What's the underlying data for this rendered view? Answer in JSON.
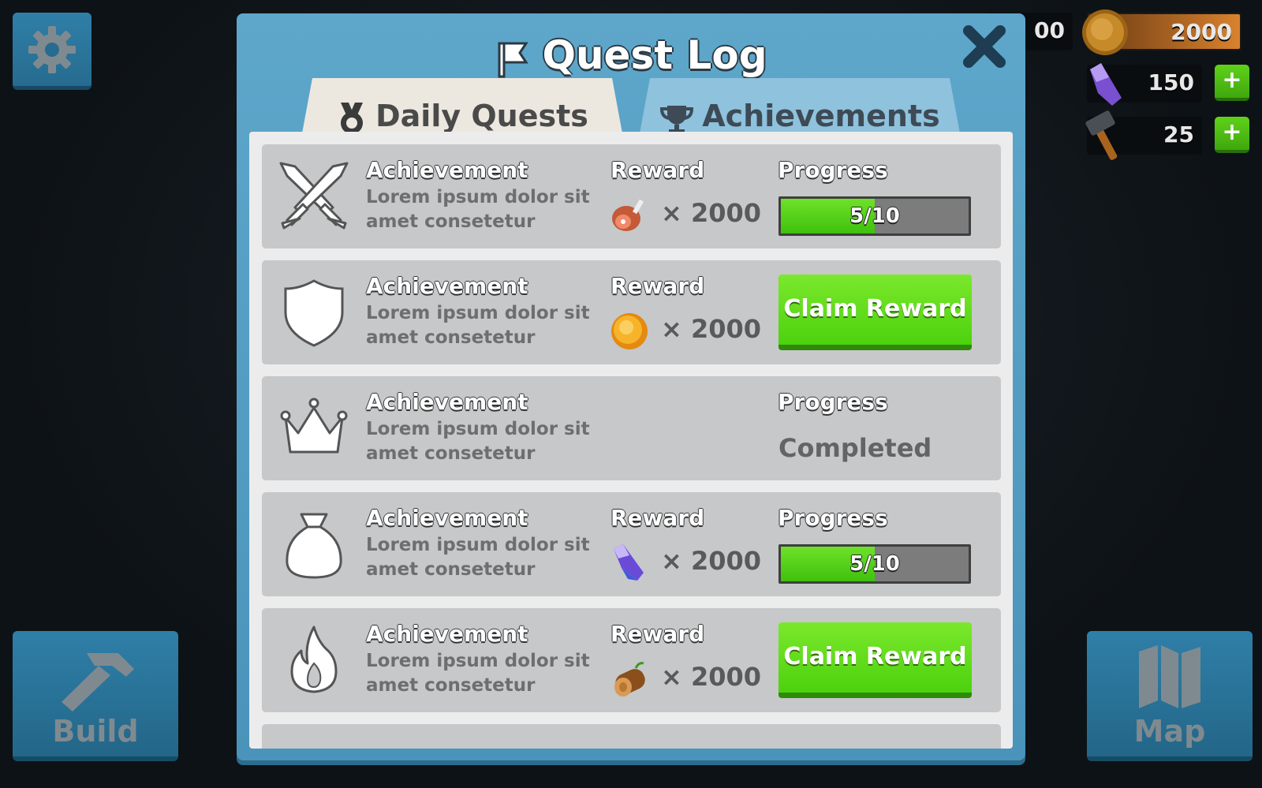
{
  "hud": {
    "build_label": "Build",
    "map_label": "Map",
    "food_partial": "00",
    "gold_value": "2000",
    "gem_value": "150",
    "hammer_value": "25",
    "plus": "+"
  },
  "modal": {
    "title": "Quest Log",
    "tabs": [
      {
        "label": "Daily Quests",
        "active": true
      },
      {
        "label": "Achievements",
        "active": false
      }
    ],
    "quests": [
      {
        "icon": "crossed-swords-icon",
        "title": "Achievement",
        "desc": "Lorem ipsum dolor sit amet consetetur",
        "reward_label": "Reward",
        "reward_icon": "meat-icon",
        "reward_amount": "× 2000",
        "progress_label": "Progress",
        "progress_text": "5/10",
        "progress_fraction": 0.5
      },
      {
        "icon": "shield-icon",
        "title": "Achievement",
        "desc": "Lorem ipsum dolor sit amet consetetur",
        "reward_label": "Reward",
        "reward_icon": "coin-icon",
        "reward_amount": "× 2000",
        "claim_label": "Claim Reward"
      },
      {
        "icon": "crown-icon",
        "title": "Achievement",
        "desc": "Lorem ipsum dolor sit amet consetetur",
        "progress_label": "Progress",
        "status": "Completed"
      },
      {
        "icon": "money-bag-icon",
        "title": "Achievement",
        "desc": "Lorem ipsum dolor sit amet consetetur",
        "reward_label": "Reward",
        "reward_icon": "crystal-icon",
        "reward_amount": "× 2000",
        "progress_label": "Progress",
        "progress_text": "5/10",
        "progress_fraction": 0.5
      },
      {
        "icon": "flame-icon",
        "title": "Achievement",
        "desc": "Lorem ipsum dolor sit amet consetetur",
        "reward_label": "Reward",
        "reward_icon": "wood-log-icon",
        "reward_amount": "× 2000",
        "claim_label": "Claim Reward"
      }
    ]
  },
  "colors": {
    "modal_blue": "#5ea7cb",
    "claim_green": "#4cd20e",
    "row_gray": "#c6c8ca"
  }
}
